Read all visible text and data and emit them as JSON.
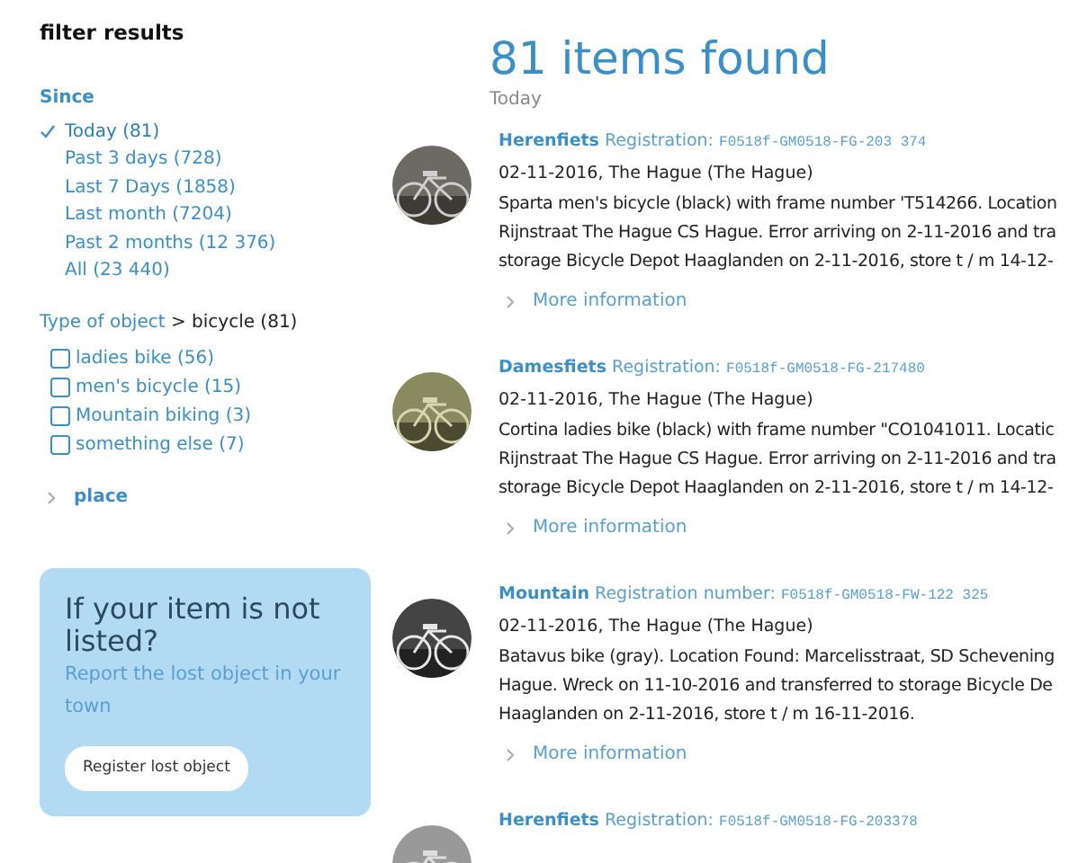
{
  "sidebar": {
    "title": "filter results",
    "since": {
      "label": "Since",
      "options": [
        {
          "label": "Today (81)",
          "selected": true
        },
        {
          "label": "Past 3 days (728)",
          "selected": false
        },
        {
          "label": "Last 7 Days (1858)",
          "selected": false
        },
        {
          "label": "Last month (7204)",
          "selected": false
        },
        {
          "label": "Past 2 months (12 376)",
          "selected": false
        },
        {
          "label": "All (23 440)",
          "selected": false
        }
      ]
    },
    "type_filter": {
      "label": "Type of object",
      "value": "> bicycle (81)",
      "options": [
        {
          "label": "ladies bike (56)",
          "checked": false
        },
        {
          "label": "men's bicycle (15)",
          "checked": false
        },
        {
          "label": "Mountain biking (3)",
          "checked": false
        },
        {
          "label": "something else (7)",
          "checked": false
        }
      ]
    },
    "place": {
      "label": "place",
      "expanded": false
    },
    "promo": {
      "title": "If your item is not listed?",
      "text": "Report the lost object in your town",
      "button": "Register lost object"
    }
  },
  "results": {
    "heading": "81 items found",
    "group": "Today",
    "items": [
      {
        "type": "Herenfiets",
        "reg_label": "Registration:",
        "reg_number": "F0518f-GM0518-FG-203 374",
        "date_place": "02-11-2016, The Hague (The Hague)",
        "description": [
          "Sparta men's bicycle (black) with frame number 'T514266. Location",
          "Rijnstraat The Hague CS Hague. Error arriving on 2-11-2016 and tra",
          "storage Bicycle Depot Haaglanden on 2-11-2016, store t / m 14-12-"
        ],
        "more": "More information"
      },
      {
        "type": "Damesfiets",
        "reg_label": "Registration:",
        "reg_number": "F0518f-GM0518-FG-217480",
        "date_place": "02-11-2016, The Hague (The Hague)",
        "description": [
          "Cortina ladies bike (black) with frame number \"CO1041011. Locatic",
          "Rijnstraat The Hague CS Hague. Error arriving on 2-11-2016 and tra",
          "storage Bicycle Depot Haaglanden on 2-11-2016, store t / m 14-12-"
        ],
        "more": "More information"
      },
      {
        "type": "Mountain",
        "reg_label": "Registration number:",
        "reg_number": "F0518f-GM0518-FW-122 325",
        "date_place": "02-11-2016, The Hague (The Hague)",
        "description": [
          "Batavus bike (gray). Location Found: Marcelisstraat, SD Schevening",
          "Hague. Wreck on 11-10-2016 and transferred to storage Bicycle De",
          "Haaglanden on 2-11-2016, store t / m 16-11-2016."
        ],
        "more": "More information"
      },
      {
        "type": "Herenfiets",
        "reg_label": "Registration:",
        "reg_number": "F0518f-GM0518-FG-203378"
      }
    ]
  }
}
